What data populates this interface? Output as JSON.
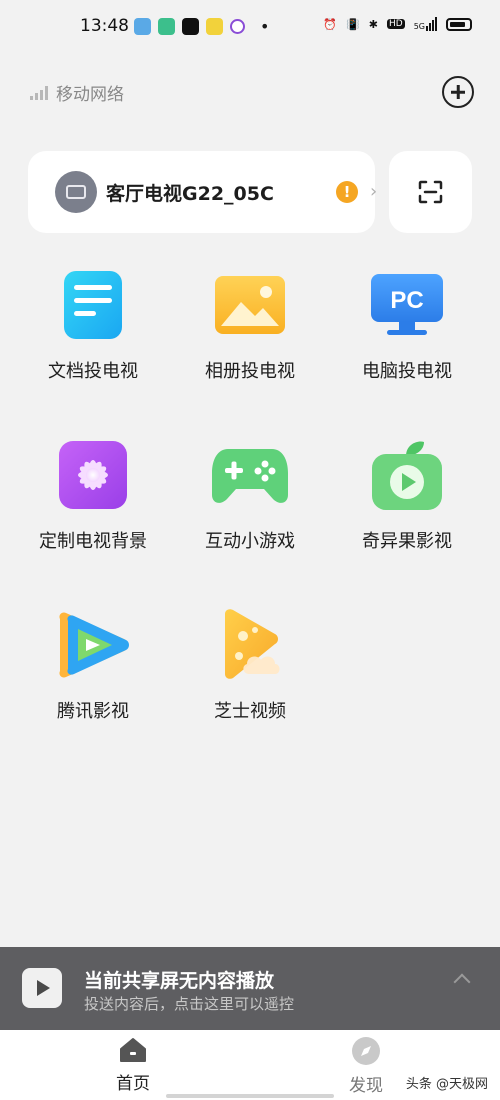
{
  "status_bar": {
    "time": "13:48",
    "notification_apps": [
      "gallery",
      "security",
      "tiktok",
      "news",
      "browser"
    ],
    "indicators": [
      "alarm-icon",
      "vibrate-icon",
      "bluetooth-icon",
      "hd-icon",
      "5g-signal-icon",
      "battery-icon"
    ],
    "hd_label": "HD",
    "network_label": "5G"
  },
  "header": {
    "network_name": "移动网络"
  },
  "device": {
    "name": "客厅电视G22_05C",
    "warning_glyph": "!"
  },
  "features": [
    {
      "label": "文档投电视",
      "icon": "document-icon",
      "color": "#3ec7f5"
    },
    {
      "label": "相册投电视",
      "icon": "photo-album-icon",
      "color": "#fbbf2e"
    },
    {
      "label": "电脑投电视",
      "icon": "pc-icon",
      "color": "#3f8ef8",
      "icon_text": "PC"
    },
    {
      "label": "定制电视背景",
      "icon": "flower-icon",
      "color": "#b64ff2"
    },
    {
      "label": "互动小游戏",
      "icon": "gamepad-icon",
      "color": "#5cd07a"
    },
    {
      "label": "奇异果影视",
      "icon": "kiwi-tv-icon",
      "color": "#6ad07a"
    },
    {
      "label": "腾讯影视",
      "icon": "tencent-video-icon",
      "color": "#3aa6f0"
    },
    {
      "label": "芝士视频",
      "icon": "cheese-video-icon",
      "color": "#fbbe3a"
    }
  ],
  "now_playing": {
    "title": "当前共享屏无内容播放",
    "subtitle": "投送内容后，点击这里可以遥控"
  },
  "tabs": [
    {
      "label": "首页",
      "active": true
    },
    {
      "label": "发现",
      "active": false
    }
  ],
  "watermark": "头条 @天极网"
}
